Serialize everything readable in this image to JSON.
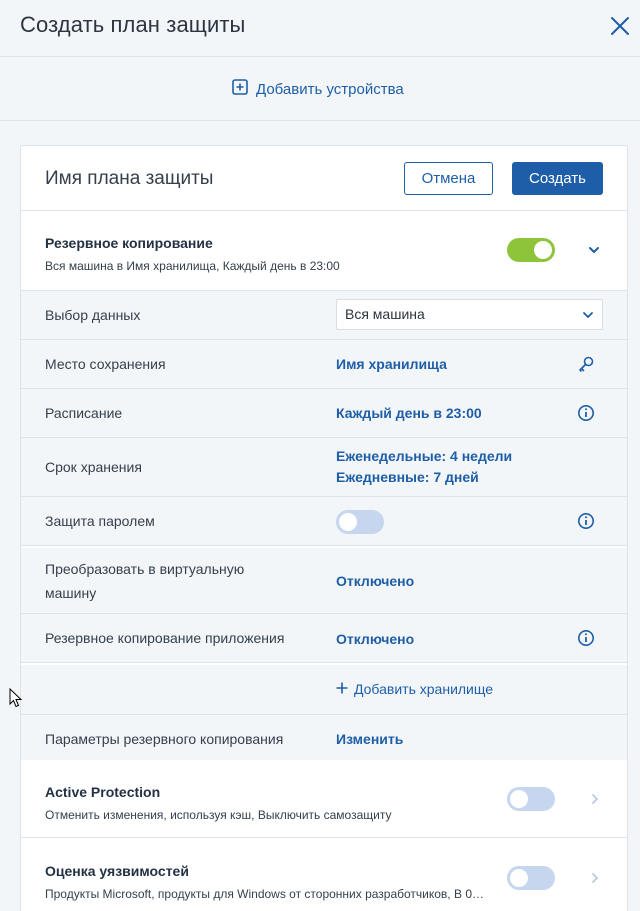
{
  "header": {
    "title": "Создать план защиты"
  },
  "add_devices": {
    "label": "Добавить устройства"
  },
  "plan": {
    "name": "Имя плана защиты",
    "cancel_label": "Отмена",
    "create_label": "Создать"
  },
  "backup": {
    "title": "Резервное копирование",
    "subtitle": "Вся машина в Имя хранилища, Каждый день в 23:00",
    "enabled": true
  },
  "rows": {
    "data_selection": {
      "label": "Выбор данных",
      "value": "Вся машина"
    },
    "destination": {
      "label": "Место сохранения",
      "value": "Имя хранилища"
    },
    "schedule": {
      "label": "Расписание",
      "value": "Каждый день в 23:00"
    },
    "retention": {
      "label": "Срок хранения",
      "value_line1": "Еженедельные: 4 недели",
      "value_line2": "Ежедневные: 7 дней"
    },
    "password": {
      "label": "Защита паролем",
      "enabled": false
    },
    "convert_vm": {
      "label": "Преобразовать в виртуальную машину",
      "value": "Отключено"
    },
    "app_backup": {
      "label": "Резервное копирование приложения",
      "value": "Отключено"
    },
    "add_storage": {
      "label": "Добавить хранилище"
    },
    "backup_options": {
      "label": "Параметры резервного копирования",
      "value": "Изменить"
    }
  },
  "active_protection": {
    "title": "Active Protection",
    "subtitle": "Отменить изменения, используя кэш, Выключить самозащиту",
    "enabled": false
  },
  "vulnerability": {
    "title": "Оценка уязвимостей",
    "subtitle": "Продукты Microsoft, продукты для Windows от сторонних разработчиков, В 0…",
    "enabled": false
  },
  "colors": {
    "accent": "#1e5ea8",
    "toggle_on": "#8dc43a",
    "toggle_off": "#c5d6ee"
  }
}
